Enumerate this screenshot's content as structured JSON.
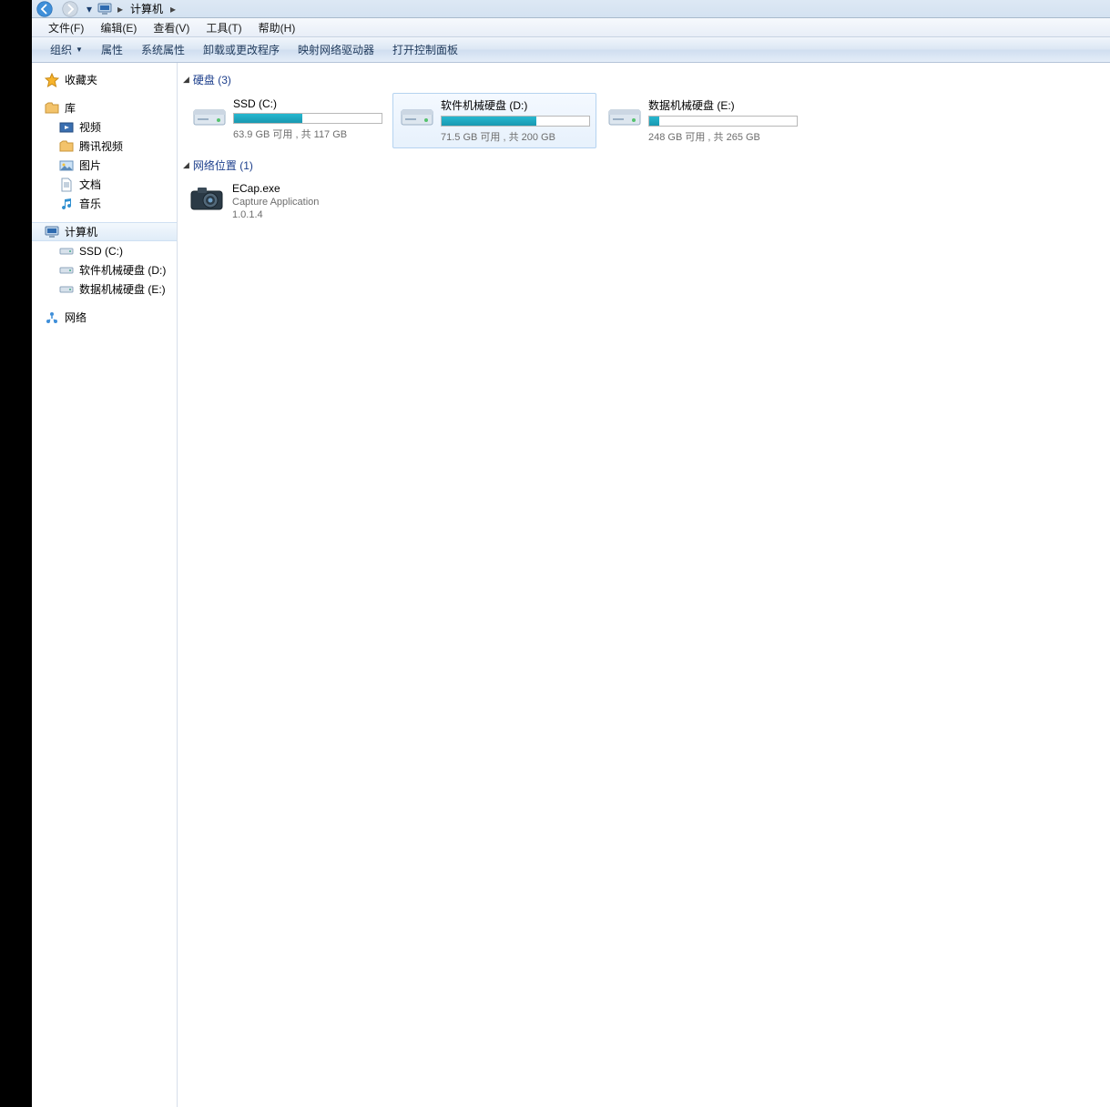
{
  "nav": {
    "location": "计算机"
  },
  "menubar": [
    "文件(F)",
    "编辑(E)",
    "查看(V)",
    "工具(T)",
    "帮助(H)"
  ],
  "toolbar": {
    "organize": "组织",
    "items": [
      "属性",
      "系统属性",
      "卸载或更改程序",
      "映射网络驱动器",
      "打开控制面板"
    ]
  },
  "sidebar": {
    "favorites": "收藏夹",
    "library": "库",
    "library_items": [
      "视频",
      "腾讯视频",
      "图片",
      "文档",
      "音乐"
    ],
    "computer": "计算机",
    "computer_items": [
      "SSD (C:)",
      "软件机械硬盘 (D:)",
      "数据机械硬盘 (E:)"
    ],
    "network": "网络"
  },
  "content": {
    "hdd_header": "硬盘 (3)",
    "drives": [
      {
        "name": "SSD (C:)",
        "sub": "63.9 GB 可用 , 共 117 GB",
        "fill": 46,
        "selected": false
      },
      {
        "name": "软件机械硬盘 (D:)",
        "sub": "71.5 GB 可用 , 共 200 GB",
        "fill": 64,
        "selected": true
      },
      {
        "name": "数据机械硬盘 (E:)",
        "sub": "248 GB 可用 , 共 265 GB",
        "fill": 7,
        "selected": false
      }
    ],
    "net_header": "网络位置 (1)",
    "net_items": [
      {
        "name": "ECap.exe",
        "desc": "Capture Application",
        "ver": "1.0.1.4"
      }
    ]
  }
}
